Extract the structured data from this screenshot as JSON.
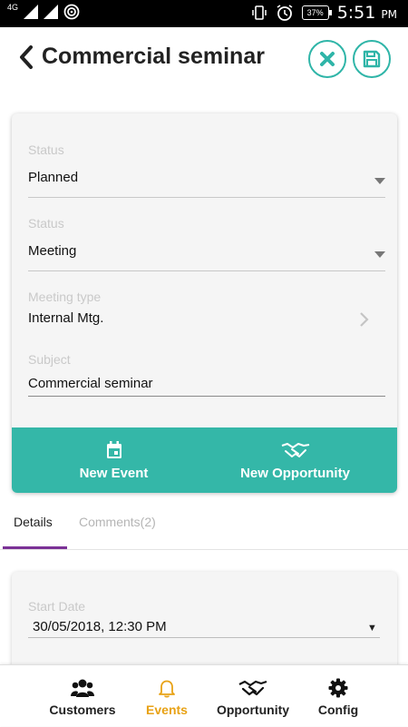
{
  "status_bar": {
    "network_1": "4G",
    "network_sub_1": "1",
    "network_sub_2": "2",
    "battery": "37%",
    "time": "5:51",
    "ampm": "PM"
  },
  "header": {
    "title": "Commercial seminar",
    "accent_color": "#2fb5a8"
  },
  "form": {
    "status1": {
      "label": "Status",
      "value": "Planned"
    },
    "status2": {
      "label": "Status",
      "value": "Meeting"
    },
    "meeting_type": {
      "label": "Meeting type",
      "value": "Internal Mtg."
    },
    "subject": {
      "label": "Subject",
      "value": "Commercial seminar"
    },
    "actions": {
      "new_event": "New Event",
      "new_opportunity": "New Opportunity",
      "color": "#34b7a8"
    }
  },
  "tabs": {
    "details": "Details",
    "comments": "Comments(2)",
    "active": "details",
    "indicator_color": "#7b3296"
  },
  "details": {
    "start_date_label": "Start Date",
    "start_date_value": "30/05/2018, 12:30 PM"
  },
  "bottom_nav": {
    "items": [
      {
        "label": "Customers",
        "icon": "people-icon"
      },
      {
        "label": "Events",
        "icon": "bell-icon"
      },
      {
        "label": "Opportunity",
        "icon": "handshake-icon"
      },
      {
        "label": "Config",
        "icon": "gear-icon"
      }
    ],
    "active_index": 1,
    "active_color": "#e8a215"
  }
}
